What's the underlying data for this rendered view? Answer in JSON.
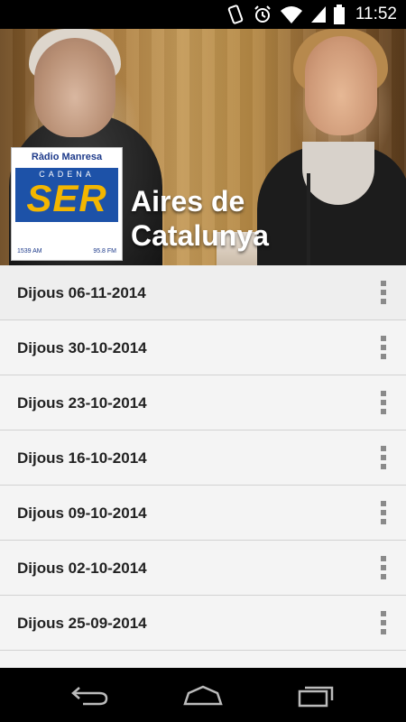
{
  "status_bar": {
    "time": "11:52",
    "icons": [
      "vibrate-icon",
      "alarm-icon",
      "wifi-icon",
      "signal-icon",
      "battery-icon"
    ]
  },
  "header": {
    "title": "Aires de Catalunya",
    "logo": {
      "radio": "Ràdio Manresa",
      "cadena": "CADENA",
      "ser": "SER",
      "am": "1539 AM",
      "fm": "95.8 FM"
    }
  },
  "episodes": [
    {
      "label": "Dijous 06-11-2014"
    },
    {
      "label": "Dijous 30-10-2014"
    },
    {
      "label": "Dijous 23-10-2014"
    },
    {
      "label": "Dijous 16-10-2014"
    },
    {
      "label": "Dijous 09-10-2014"
    },
    {
      "label": "Dijous 02-10-2014"
    },
    {
      "label": "Dijous 25-09-2014"
    }
  ],
  "nav_bar": {
    "buttons": [
      "back-icon",
      "home-icon",
      "recent-apps-icon"
    ]
  },
  "colors": {
    "status_bar": "#000000",
    "list_bg": "#f4f4f4",
    "overflow_dots": "#8a8a8a",
    "logo_blue": "#1d52a8",
    "logo_yellow": "#f3b600"
  }
}
